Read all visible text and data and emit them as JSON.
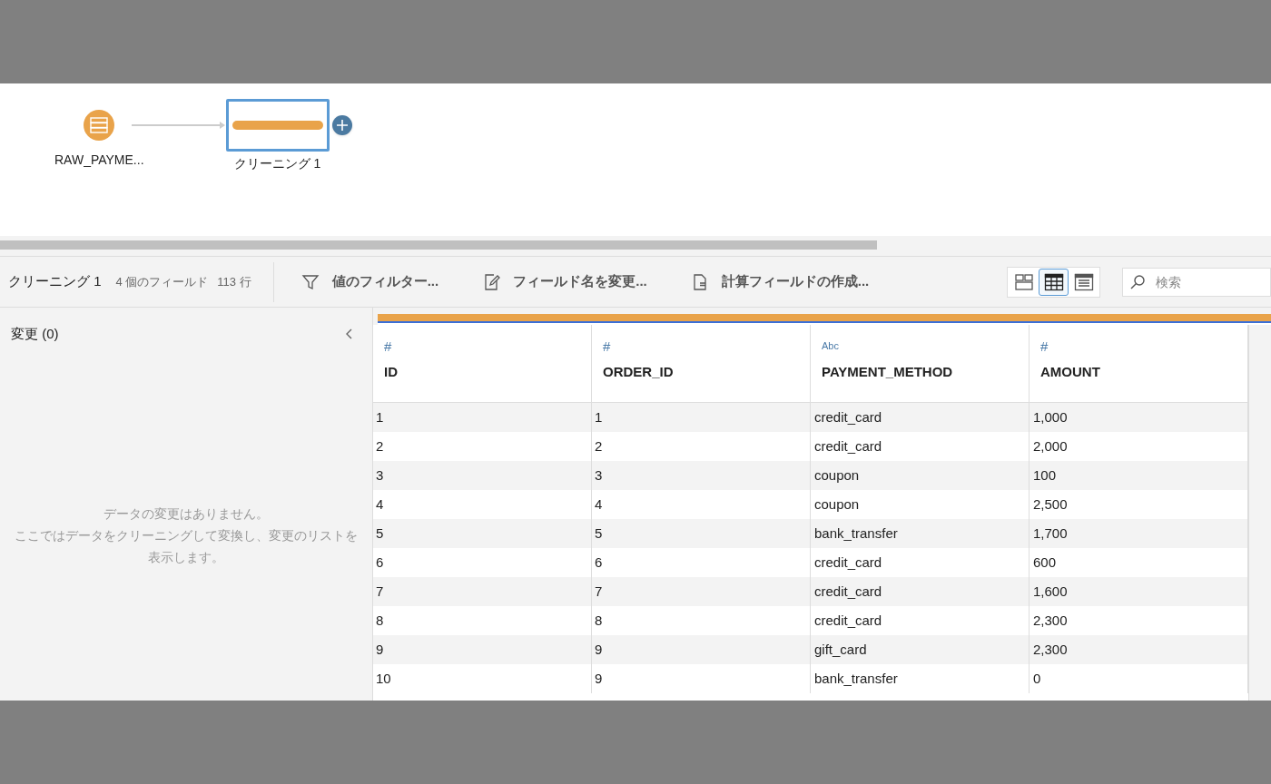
{
  "flow": {
    "nodes": [
      {
        "kind": "input",
        "label": "RAW_PAYME...",
        "selected": false
      },
      {
        "kind": "clean",
        "label": "クリーニング 1",
        "selected": true
      }
    ]
  },
  "toolbar": {
    "step_name": "クリーニング 1",
    "field_count": "4 個のフィールド",
    "row_count": "113 行",
    "actions": [
      {
        "kind": "filter",
        "label": "値のフィルター..."
      },
      {
        "kind": "rename",
        "label": "フィールド名を変更..."
      },
      {
        "kind": "calc",
        "label": "計算フィールドの作成..."
      }
    ],
    "views": [
      {
        "kind": "cards",
        "selected": false
      },
      {
        "kind": "grid",
        "selected": true
      },
      {
        "kind": "list",
        "selected": false
      }
    ],
    "search": {
      "placeholder": "検索"
    }
  },
  "changes_panel": {
    "title": "変更 (0)",
    "empty_title": "データの変更はありません。",
    "empty_text": "ここではデータをクリーニングして変換し、変更のリストを表示します。"
  },
  "table": {
    "columns": [
      {
        "type": "#",
        "name": "ID"
      },
      {
        "type": "#",
        "name": "ORDER_ID"
      },
      {
        "type": "Abc",
        "name": "PAYMENT_METHOD"
      },
      {
        "type": "#",
        "name": "AMOUNT"
      }
    ],
    "rows": [
      [
        "1",
        "1",
        "credit_card",
        "1,000"
      ],
      [
        "2",
        "2",
        "credit_card",
        "2,000"
      ],
      [
        "3",
        "3",
        "coupon",
        "100"
      ],
      [
        "4",
        "4",
        "coupon",
        "2,500"
      ],
      [
        "5",
        "5",
        "bank_transfer",
        "1,700"
      ],
      [
        "6",
        "6",
        "credit_card",
        "600"
      ],
      [
        "7",
        "7",
        "credit_card",
        "1,600"
      ],
      [
        "8",
        "8",
        "credit_card",
        "2,300"
      ],
      [
        "9",
        "9",
        "gift_card",
        "2,300"
      ],
      [
        "10",
        "9",
        "bank_transfer",
        "0"
      ]
    ]
  }
}
